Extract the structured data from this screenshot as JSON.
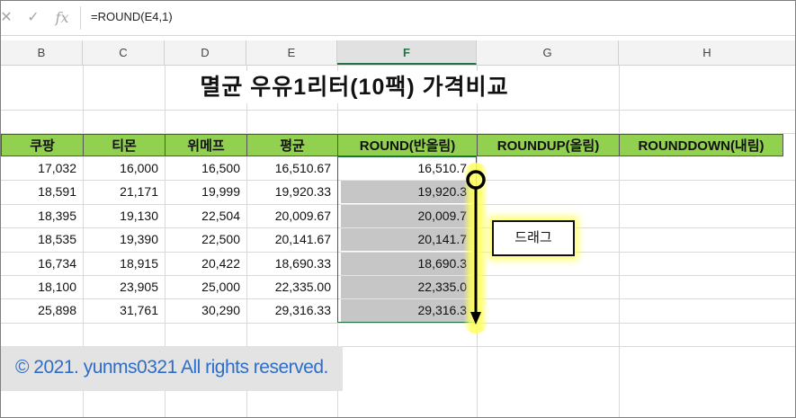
{
  "formula_bar": {
    "cancel_icon": "x-icon",
    "enter_icon": "check-icon",
    "fx_label": "fx",
    "formula": "=ROUND(E4,1)"
  },
  "columns": {
    "B": "B",
    "C": "C",
    "D": "D",
    "E": "E",
    "F": "F",
    "G": "G",
    "H": "H",
    "active": "F"
  },
  "sheet": {
    "title": "멸균 우유1리터(10팩) 가격비교",
    "headers": [
      "쿠팡",
      "티몬",
      "위메프",
      "평균",
      "ROUND(반올림)",
      "ROUNDUP(올림)",
      "ROUNDDOWN(내림)"
    ],
    "rows": [
      [
        "17,032",
        "16,000",
        "16,500",
        "16,510.67",
        "16,510.7"
      ],
      [
        "18,591",
        "21,171",
        "19,999",
        "19,920.33",
        "19,920.3"
      ],
      [
        "18,395",
        "19,130",
        "22,504",
        "20,009.67",
        "20,009.7"
      ],
      [
        "18,535",
        "19,390",
        "22,500",
        "20,141.67",
        "20,141.7"
      ],
      [
        "16,734",
        "18,915",
        "20,422",
        "18,690.33",
        "18,690.3"
      ],
      [
        "18,100",
        "23,905",
        "25,000",
        "22,335.00",
        "22,335.0"
      ],
      [
        "25,898",
        "31,761",
        "30,290",
        "29,316.33",
        "29,316.3"
      ]
    ]
  },
  "annotation": {
    "drag_label": "드래그",
    "highlight_color": "#ffff5a"
  },
  "watermark": {
    "text": "© 2021. yunms0321 All rights reserved."
  },
  "colors": {
    "header_fill": "#92d050",
    "selection": "#217346",
    "filled_cells": "#c6c6c6"
  }
}
